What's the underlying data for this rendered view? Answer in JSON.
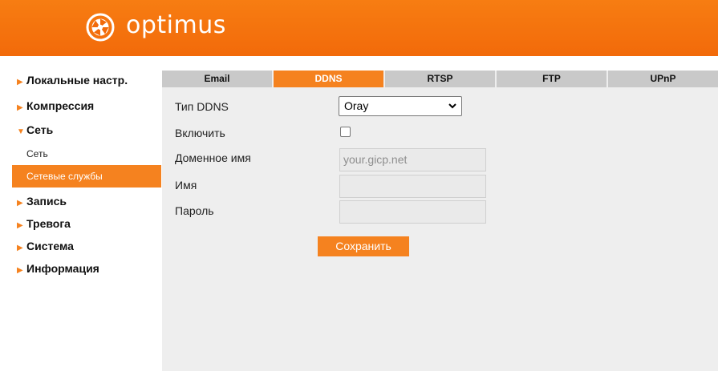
{
  "brand": {
    "name": "optimus",
    "color": "#f5821f"
  },
  "sidebar": {
    "items": [
      {
        "label": "Локальные настр.",
        "marker": "▶"
      },
      {
        "label": "Компрессия",
        "marker": "▶"
      },
      {
        "label": "Сеть",
        "marker": "▼",
        "expanded": true,
        "children": [
          {
            "label": "Сеть",
            "active": false
          },
          {
            "label": "Сетевые службы",
            "active": true
          }
        ]
      },
      {
        "label": "Запись",
        "marker": "▶"
      },
      {
        "label": "Тревога",
        "marker": "▶"
      },
      {
        "label": "Система",
        "marker": "▶"
      },
      {
        "label": "Информация",
        "marker": "▶"
      }
    ]
  },
  "tabs": [
    {
      "label": "Email",
      "active": false
    },
    {
      "label": "DDNS",
      "active": true
    },
    {
      "label": "RTSP",
      "active": false
    },
    {
      "label": "FTP",
      "active": false
    },
    {
      "label": "UPnP",
      "active": false
    }
  ],
  "form": {
    "ddns_type_label": "Тип DDNS",
    "ddns_type_value": "Oray",
    "enable_label": "Включить",
    "enable_checked": false,
    "domain_label": "Доменное имя",
    "domain_placeholder": "your.gicp.net",
    "name_label": "Имя",
    "name_value": "",
    "password_label": "Пароль",
    "password_value": "",
    "save_label": "Сохранить"
  }
}
